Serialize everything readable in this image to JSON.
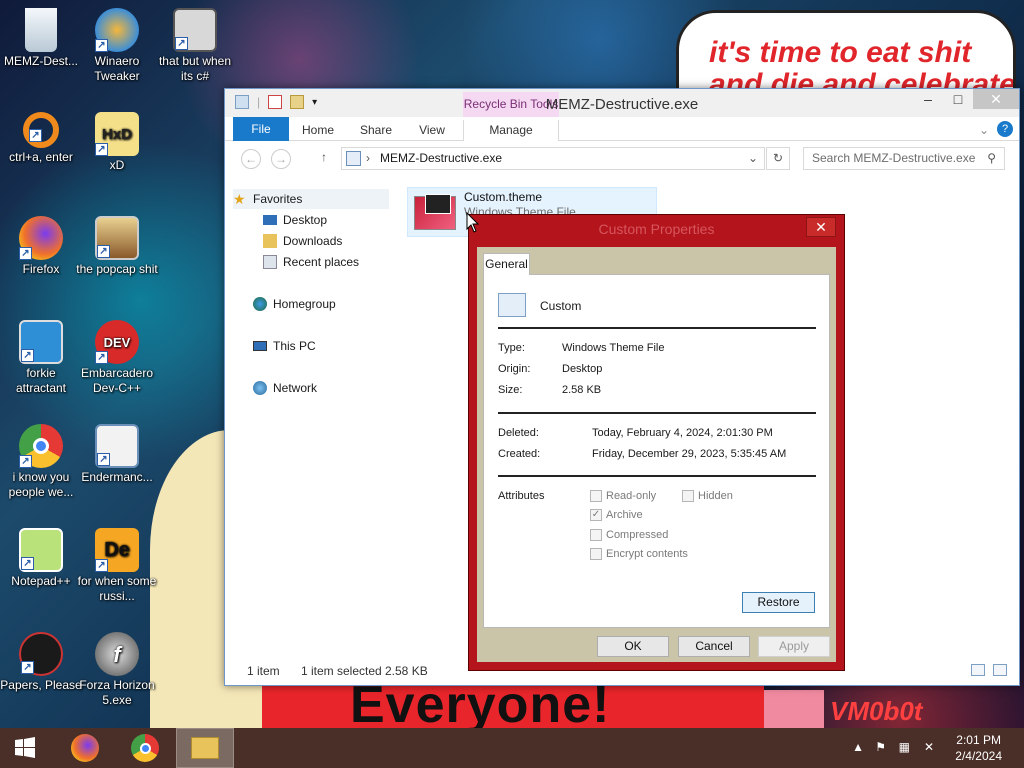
{
  "desktop": {
    "meme_text": "it's time to eat shit",
    "meme_text2": "and die and celebrate",
    "banner_text": "Everyone!",
    "watermark_text": "VM0b0t",
    "icons": [
      {
        "label": "MEMZ-Dest...",
        "icon": "recycle-bin-icon"
      },
      {
        "label": "Winaero Tweaker",
        "icon": "winaero-icon"
      },
      {
        "label": "that but when its c#",
        "icon": "stacked-windows-icon"
      },
      {
        "label": "ctrl+a, enter",
        "icon": "orange-ring-icon"
      },
      {
        "label": "xD",
        "icon": "hxd-icon"
      },
      {
        "label": "Firefox",
        "icon": "firefox-icon"
      },
      {
        "label": "the popcap shit",
        "icon": "popcap-icon"
      },
      {
        "label": "forkie attractant",
        "icon": "monitor-gear-icon"
      },
      {
        "label": "Embarcadero Dev-C++",
        "icon": "devcpp-icon"
      },
      {
        "label": "i know you people we...",
        "icon": "chrome-icon"
      },
      {
        "label": "Endermanc...",
        "icon": "window-app-icon"
      },
      {
        "label": "Notepad++",
        "icon": "notepadpp-icon"
      },
      {
        "label": "for when some russi...",
        "icon": "de-icon"
      },
      {
        "label": "Papers, Please",
        "icon": "papers-please-icon"
      },
      {
        "label": "Forza Horizon 5.exe",
        "icon": "flash-icon"
      }
    ]
  },
  "explorer": {
    "title": "MEMZ-Destructive.exe",
    "context_tab": "Recycle Bin Tools",
    "ribbon_tabs": [
      "File",
      "Home",
      "Share",
      "View"
    ],
    "manage_tab": "Manage",
    "address": "MEMZ-Destructive.exe",
    "search_placeholder": "Search MEMZ-Destructive.exe",
    "nav": {
      "favorites": "Favorites",
      "desktop": "Desktop",
      "downloads": "Downloads",
      "recent": "Recent places",
      "homegroup": "Homegroup",
      "thispc": "This PC",
      "network": "Network"
    },
    "file": {
      "name": "Custom.theme",
      "type": "Windows Theme File"
    },
    "status": {
      "count": "1 item",
      "selected": "1 item selected",
      "size": "2.58 KB"
    }
  },
  "dialog": {
    "title": "Custom Properties",
    "tab": "General",
    "name": "Custom",
    "type_label": "Type:",
    "type_value": "Windows Theme File",
    "origin_label": "Origin:",
    "origin_value": "Desktop",
    "size_label": "Size:",
    "size_value": "2.58 KB",
    "deleted_label": "Deleted:",
    "deleted_value": "Today, February 4, 2024, 2:01:30 PM",
    "created_label": "Created:",
    "created_value": "Friday, December 29, 2023, 5:35:45 AM",
    "attributes_label": "Attributes",
    "attrs": {
      "readonly": "Read-only",
      "hidden": "Hidden",
      "archive": "Archive",
      "compressed": "Compressed",
      "encrypt": "Encrypt contents"
    },
    "buttons": {
      "restore": "Restore",
      "ok": "OK",
      "cancel": "Cancel",
      "apply": "Apply"
    }
  },
  "taskbar": {
    "time": "2:01 PM",
    "date": "2/4/2024"
  }
}
